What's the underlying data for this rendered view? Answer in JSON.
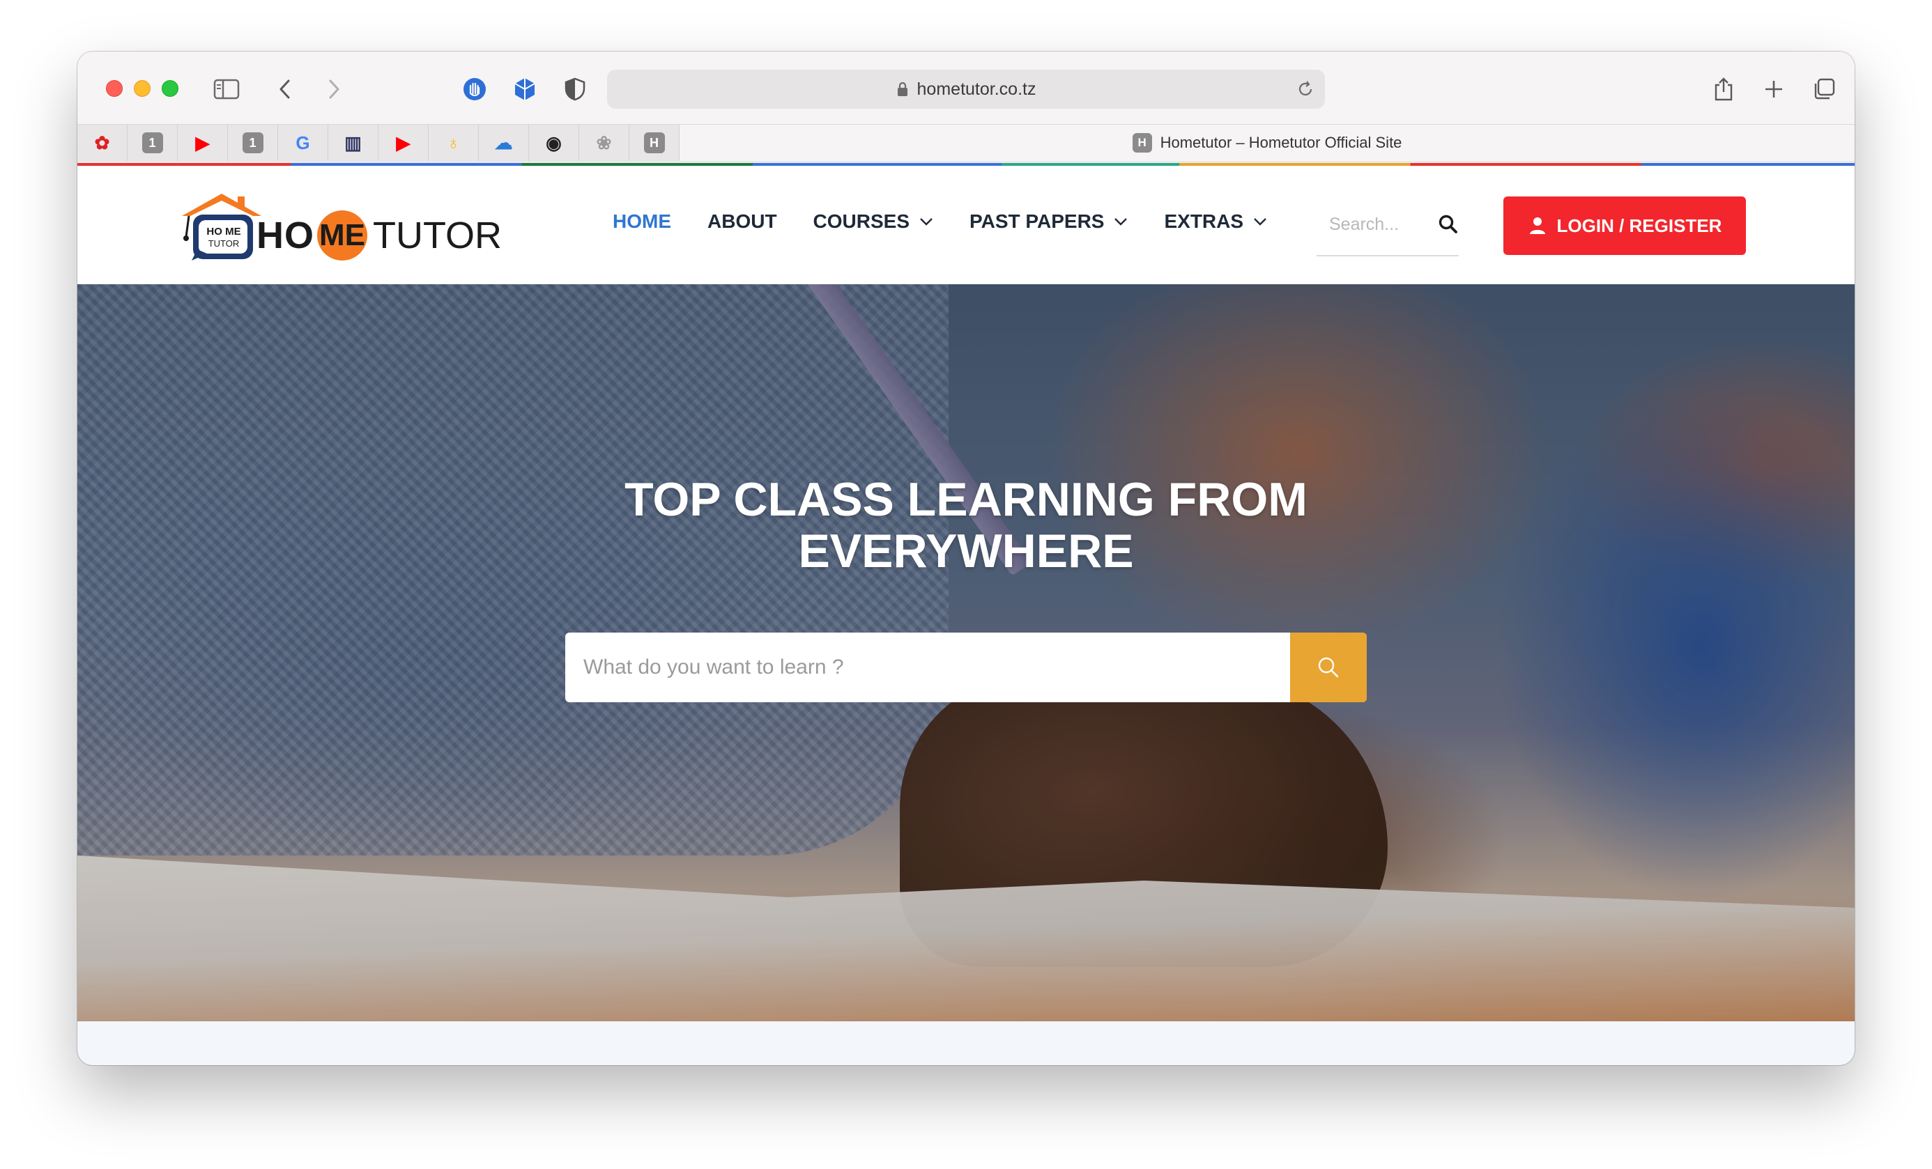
{
  "browser": {
    "url": "hometutor.co.tz",
    "active_tab_favicon": "H",
    "active_tab_title": "Hometutor – Hometutor Official Site",
    "pinned_tabs": [
      {
        "icon": "huawei-icon",
        "glyph": "✿",
        "color": "#e02020"
      },
      {
        "icon": "onepassword-icon",
        "glyph": "1",
        "color": "#8a8a8a"
      },
      {
        "icon": "youtube-icon",
        "glyph": "▶",
        "color": "#ff0000"
      },
      {
        "icon": "onepassword-icon",
        "glyph": "1",
        "color": "#8a8a8a"
      },
      {
        "icon": "google-icon",
        "glyph": "G",
        "color": "#4285f4"
      },
      {
        "icon": "app-icon",
        "glyph": "▥",
        "color": "#2d3560"
      },
      {
        "icon": "youtube-icon",
        "glyph": "▶",
        "color": "#ff0000"
      },
      {
        "icon": "cup-icon",
        "glyph": "♁",
        "color": "#f0c000"
      },
      {
        "icon": "cloud-icon",
        "glyph": "☁",
        "color": "#2a7ad8"
      },
      {
        "icon": "app-icon",
        "glyph": "◉",
        "color": "#222222"
      },
      {
        "icon": "flower-icon",
        "glyph": "❀",
        "color": "#9a9a9a"
      },
      {
        "icon": "hometutor-icon",
        "glyph": "H",
        "color": "#8a8a8a"
      }
    ]
  },
  "site": {
    "logo": {
      "badge_top": "HO ME",
      "badge_bottom": "TUTOR",
      "ho": "HO",
      "me": "ME",
      "tutor": "TUTOR"
    },
    "nav": [
      {
        "label": "HOME",
        "active": true,
        "dropdown": false
      },
      {
        "label": "ABOUT",
        "active": false,
        "dropdown": false
      },
      {
        "label": "COURSES",
        "active": false,
        "dropdown": true
      },
      {
        "label": "PAST PAPERS",
        "active": false,
        "dropdown": true
      },
      {
        "label": "EXTRAS",
        "active": false,
        "dropdown": true
      }
    ],
    "search_placeholder": "Search...",
    "login_label": "LOGIN / REGISTER",
    "colors": {
      "accent_blue": "#2f77cf",
      "login_red": "#f2262c",
      "search_orange": "#e8a532",
      "logo_orange": "#f47920"
    }
  },
  "hero": {
    "title_line1": "TOP CLASS LEARNING FROM",
    "title_line2": "EVERYWHERE",
    "search_placeholder": "What do you want to learn ?"
  }
}
